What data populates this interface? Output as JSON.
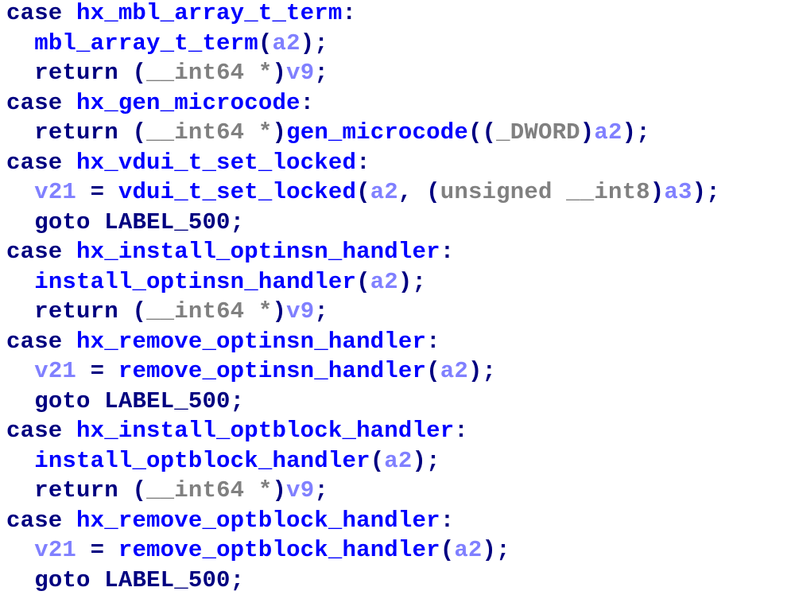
{
  "colors": {
    "keyword": "#000080",
    "function": "#0000ff",
    "variable": "#8080ff",
    "type": "#808080",
    "background": "#ffffff"
  },
  "lines": [
    {
      "indent": "",
      "tokens": [
        {
          "c": "k",
          "t": "case "
        },
        {
          "c": "f",
          "t": "hx_mbl_array_t_term"
        },
        {
          "c": "p",
          "t": ":"
        }
      ]
    },
    {
      "indent": "  ",
      "tokens": [
        {
          "c": "f",
          "t": "mbl_array_t_term"
        },
        {
          "c": "p",
          "t": "("
        },
        {
          "c": "v",
          "t": "a2"
        },
        {
          "c": "p",
          "t": ");"
        }
      ]
    },
    {
      "indent": "  ",
      "tokens": [
        {
          "c": "k",
          "t": "return "
        },
        {
          "c": "p",
          "t": "("
        },
        {
          "c": "t",
          "t": "__int64 *"
        },
        {
          "c": "p",
          "t": ")"
        },
        {
          "c": "v",
          "t": "v9"
        },
        {
          "c": "p",
          "t": ";"
        }
      ]
    },
    {
      "indent": "",
      "tokens": [
        {
          "c": "k",
          "t": "case "
        },
        {
          "c": "f",
          "t": "hx_gen_microcode"
        },
        {
          "c": "p",
          "t": ":"
        }
      ]
    },
    {
      "indent": "  ",
      "tokens": [
        {
          "c": "k",
          "t": "return "
        },
        {
          "c": "p",
          "t": "("
        },
        {
          "c": "t",
          "t": "__int64 *"
        },
        {
          "c": "p",
          "t": ")"
        },
        {
          "c": "f",
          "t": "gen_microcode"
        },
        {
          "c": "p",
          "t": "(("
        },
        {
          "c": "t",
          "t": "_DWORD"
        },
        {
          "c": "p",
          "t": ")"
        },
        {
          "c": "v",
          "t": "a2"
        },
        {
          "c": "p",
          "t": ");"
        }
      ]
    },
    {
      "indent": "",
      "tokens": [
        {
          "c": "k",
          "t": "case "
        },
        {
          "c": "f",
          "t": "hx_vdui_t_set_locked"
        },
        {
          "c": "p",
          "t": ":"
        }
      ]
    },
    {
      "indent": "  ",
      "tokens": [
        {
          "c": "v",
          "t": "v21"
        },
        {
          "c": "p",
          "t": " = "
        },
        {
          "c": "f",
          "t": "vdui_t_set_locked"
        },
        {
          "c": "p",
          "t": "("
        },
        {
          "c": "v",
          "t": "a2"
        },
        {
          "c": "p",
          "t": ", ("
        },
        {
          "c": "t",
          "t": "unsigned __int8"
        },
        {
          "c": "p",
          "t": ")"
        },
        {
          "c": "v",
          "t": "a3"
        },
        {
          "c": "p",
          "t": ");"
        }
      ]
    },
    {
      "indent": "  ",
      "tokens": [
        {
          "c": "k",
          "t": "goto LABEL_500;"
        }
      ]
    },
    {
      "indent": "",
      "tokens": [
        {
          "c": "k",
          "t": "case "
        },
        {
          "c": "f",
          "t": "hx_install_optinsn_handler"
        },
        {
          "c": "p",
          "t": ":"
        }
      ]
    },
    {
      "indent": "  ",
      "tokens": [
        {
          "c": "f",
          "t": "install_optinsn_handler"
        },
        {
          "c": "p",
          "t": "("
        },
        {
          "c": "v",
          "t": "a2"
        },
        {
          "c": "p",
          "t": ");"
        }
      ]
    },
    {
      "indent": "  ",
      "tokens": [
        {
          "c": "k",
          "t": "return "
        },
        {
          "c": "p",
          "t": "("
        },
        {
          "c": "t",
          "t": "__int64 *"
        },
        {
          "c": "p",
          "t": ")"
        },
        {
          "c": "v",
          "t": "v9"
        },
        {
          "c": "p",
          "t": ";"
        }
      ]
    },
    {
      "indent": "",
      "tokens": [
        {
          "c": "k",
          "t": "case "
        },
        {
          "c": "f",
          "t": "hx_remove_optinsn_handler"
        },
        {
          "c": "p",
          "t": ":"
        }
      ]
    },
    {
      "indent": "  ",
      "tokens": [
        {
          "c": "v",
          "t": "v21"
        },
        {
          "c": "p",
          "t": " = "
        },
        {
          "c": "f",
          "t": "remove_optinsn_handler"
        },
        {
          "c": "p",
          "t": "("
        },
        {
          "c": "v",
          "t": "a2"
        },
        {
          "c": "p",
          "t": ");"
        }
      ]
    },
    {
      "indent": "  ",
      "tokens": [
        {
          "c": "k",
          "t": "goto LABEL_500;"
        }
      ]
    },
    {
      "indent": "",
      "tokens": [
        {
          "c": "k",
          "t": "case "
        },
        {
          "c": "f",
          "t": "hx_install_optblock_handler"
        },
        {
          "c": "p",
          "t": ":"
        }
      ]
    },
    {
      "indent": "  ",
      "tokens": [
        {
          "c": "f",
          "t": "install_optblock_handler"
        },
        {
          "c": "p",
          "t": "("
        },
        {
          "c": "v",
          "t": "a2"
        },
        {
          "c": "p",
          "t": ");"
        }
      ]
    },
    {
      "indent": "  ",
      "tokens": [
        {
          "c": "k",
          "t": "return "
        },
        {
          "c": "p",
          "t": "("
        },
        {
          "c": "t",
          "t": "__int64 *"
        },
        {
          "c": "p",
          "t": ")"
        },
        {
          "c": "v",
          "t": "v9"
        },
        {
          "c": "p",
          "t": ";"
        }
      ]
    },
    {
      "indent": "",
      "tokens": [
        {
          "c": "k",
          "t": "case "
        },
        {
          "c": "f",
          "t": "hx_remove_optblock_handler"
        },
        {
          "c": "p",
          "t": ":"
        }
      ]
    },
    {
      "indent": "  ",
      "tokens": [
        {
          "c": "v",
          "t": "v21"
        },
        {
          "c": "p",
          "t": " = "
        },
        {
          "c": "f",
          "t": "remove_optblock_handler"
        },
        {
          "c": "p",
          "t": "("
        },
        {
          "c": "v",
          "t": "a2"
        },
        {
          "c": "p",
          "t": ");"
        }
      ]
    },
    {
      "indent": "  ",
      "tokens": [
        {
          "c": "k",
          "t": "goto LABEL_500;"
        }
      ]
    }
  ]
}
